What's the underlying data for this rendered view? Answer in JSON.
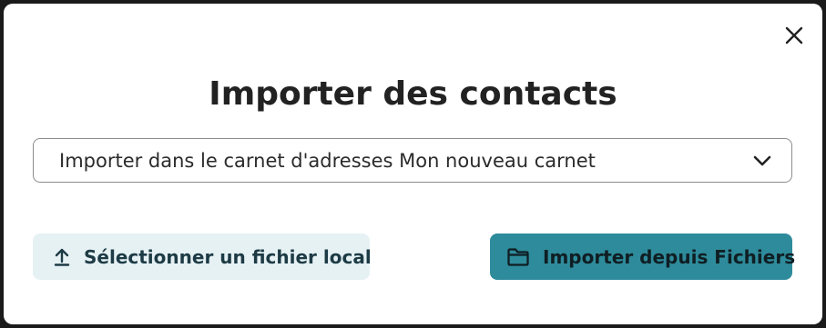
{
  "dialog": {
    "title": "Importer des contacts",
    "close_icon": "close-icon"
  },
  "addressbook_select": {
    "selected": "Importer dans le carnet d'adresses Mon nouveau carnet",
    "icon": "chevron-down-icon"
  },
  "actions": {
    "local_file_label": "Sélectionner un fichier local",
    "local_file_icon": "upload-icon",
    "files_label": "Importer depuis Fichiers",
    "files_icon": "folder-icon"
  },
  "colors": {
    "primary": "#2e8b9b",
    "secondary_bg": "#e6f1f4",
    "text": "#222222"
  }
}
